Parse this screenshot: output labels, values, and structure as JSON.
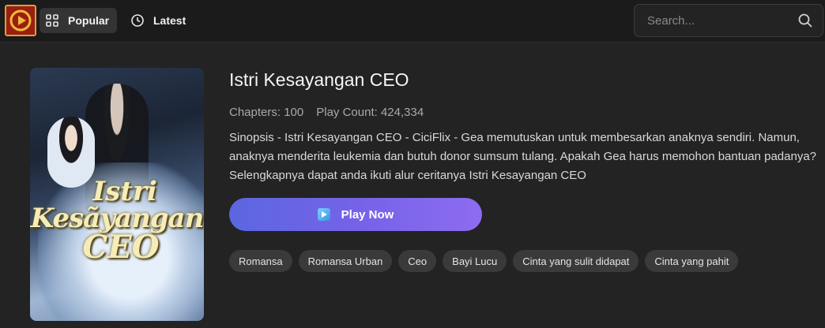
{
  "header": {
    "logo_icon": "play-logo-icon",
    "nav": [
      {
        "label": "Popular",
        "icon": "grid-icon",
        "active": true
      },
      {
        "label": "Latest",
        "icon": "clock-icon",
        "active": false
      }
    ],
    "search": {
      "placeholder": "Search...",
      "icon": "search-icon"
    }
  },
  "drama": {
    "title": "Istri Kesayangan CEO",
    "poster_text": [
      "Istri",
      "Kesãyangan",
      "CEO"
    ],
    "chapters": "Chapters: 100",
    "play_count": "Play Count: 424,334",
    "synopsis": "Sinopsis - Istri Kesayangan CEO - CiciFlix - Gea memutuskan untuk membesarkan anaknya sendiri. Namun, anaknya menderita leukemia dan butuh donor sumsum tulang. Apakah Gea harus memohon bantuan padanya? Selengkapnya dapat anda ikuti alur ceritanya Istri Kesayangan CEO",
    "play_button": "Play Now",
    "tags": [
      "Romansa",
      "Romansa Urban",
      "Ceo",
      "Bayi Lucu",
      "Cinta yang sulit didapat",
      "Cinta yang pahit"
    ]
  },
  "colors": {
    "background": "#232323",
    "header": "#1b1b1b",
    "accent_start": "#5b67e0",
    "accent_end": "#8d6cf0",
    "tag_bg": "#3a3a3a"
  }
}
